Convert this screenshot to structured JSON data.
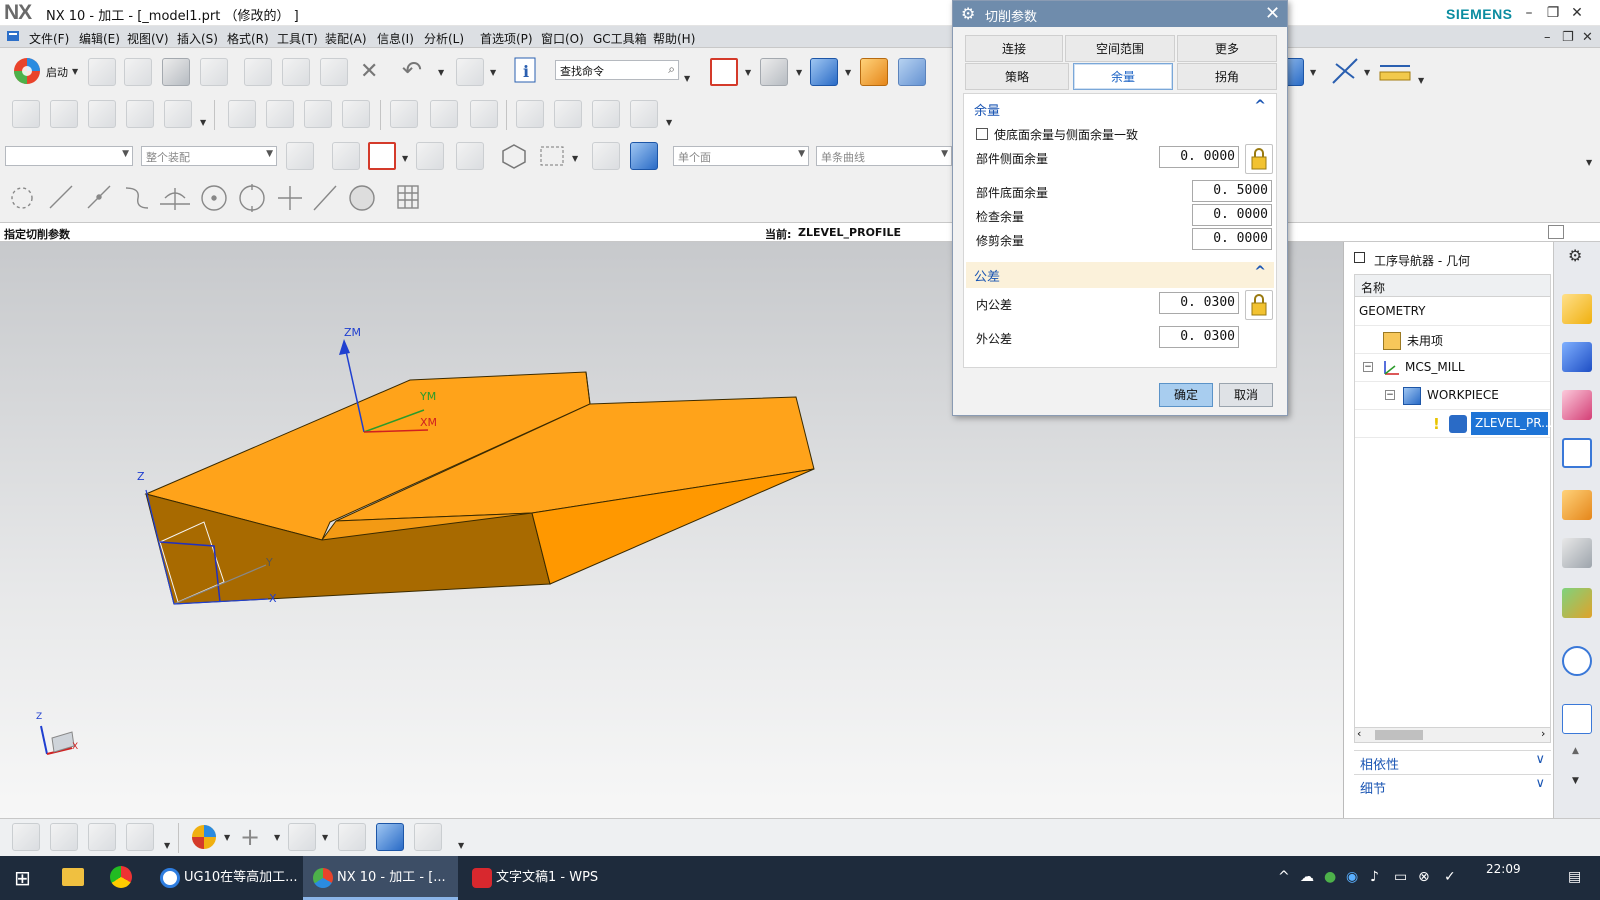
{
  "window": {
    "logo": "NX",
    "title": "NX 10 - 加工 - [_model1.prt （修改的） ]",
    "brand": "SIEMENS"
  },
  "menu": [
    "文件(F)",
    "编辑(E)",
    "视图(V)",
    "插入(S)",
    "格式(R)",
    "工具(T)",
    "装配(A)",
    "信息(I)",
    "分析(L)",
    "首选项(P)",
    "窗口(O)",
    "GC工具箱",
    "帮助(H)"
  ],
  "toolbar": {
    "start_label": "启动",
    "search_placeholder": "查找命令",
    "assembly_filter": "整个装配",
    "face_rule": "单个面",
    "curve_rule": "单条曲线"
  },
  "status": {
    "prompt": "指定切削参数",
    "current_label": "当前:",
    "current_value": "ZLEVEL_PROFILE"
  },
  "viewport": {
    "axes": {
      "zm": "ZM",
      "ym": "YM",
      "xm": "XM",
      "z": "Z",
      "y": "Y",
      "x": "X"
    }
  },
  "navigator": {
    "title": "工序导航器 - 几何",
    "column_header": "名称",
    "rows": [
      {
        "label": "GEOMETRY",
        "icon": "none"
      },
      {
        "label": "未用项",
        "icon": "unused-items-icon"
      },
      {
        "label": "MCS_MILL",
        "icon": "mcs-icon"
      },
      {
        "label": "WORKPIECE",
        "icon": "workpiece-icon"
      },
      {
        "label": "ZLEVEL_PR...",
        "icon": "zlevel-operation-icon",
        "selected": true
      }
    ],
    "sections": [
      "相依性",
      "细节"
    ]
  },
  "dialog": {
    "title": "切削参数",
    "tabs_row1": [
      "连接",
      "空间范围",
      "更多"
    ],
    "tabs_row2": [
      "策略",
      "余量",
      "拐角"
    ],
    "active_tab": "余量",
    "group_stock": {
      "title": "余量",
      "checkbox_label": "使底面余量与侧面余量一致",
      "checkbox_checked": false,
      "fields": [
        {
          "label": "部件侧面余量",
          "value": "0. 0000"
        },
        {
          "label": "部件底面余量",
          "value": "0. 5000"
        },
        {
          "label": "检查余量",
          "value": "0. 0000"
        },
        {
          "label": "修剪余量",
          "value": "0. 0000"
        }
      ]
    },
    "group_tolerance": {
      "title": "公差",
      "fields": [
        {
          "label": "内公差",
          "value": "0. 0300"
        },
        {
          "label": "外公差",
          "value": "0. 0300"
        }
      ]
    },
    "ok_label": "确定",
    "cancel_label": "取消"
  },
  "taskbar": {
    "items": [
      {
        "label": "UG10在等高加工..."
      },
      {
        "label": "NX 10 - 加工 - [..."
      },
      {
        "label": "文字文稿1 - WPS ..."
      }
    ],
    "time": "22:09"
  },
  "colors": {
    "part_top": "#ffa31a",
    "part_side": "#a86a00",
    "dialog_title": "#6f8cac",
    "accent_blue": "#1a55b3",
    "selected_row": "#1e74d6"
  }
}
